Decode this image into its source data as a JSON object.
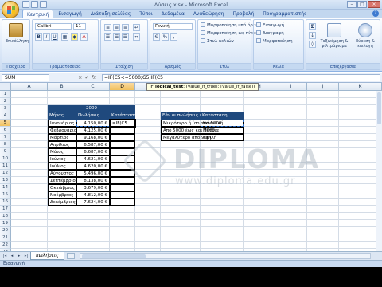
{
  "window": {
    "title": "Λύσεις.xlsx - Microsoft Excel",
    "controls": [
      "–",
      "□",
      "×"
    ]
  },
  "ribbon": {
    "tabs": [
      "Κεντρική",
      "Εισαγωγή",
      "Διάταξη σελίδας",
      "Τύποι",
      "Δεδομένα",
      "Αναθεώρηση",
      "Προβολή",
      "Προγραμματιστής"
    ],
    "active_tab": "Κεντρική",
    "groups": {
      "clipboard": {
        "label": "Πρόχειρο",
        "paste": "Επικόλληση"
      },
      "font": {
        "label": "Γραμματοσειρά",
        "font_name": "Calibri",
        "font_size": "11",
        "bold": "B",
        "italic": "I",
        "underline": "U"
      },
      "alignment": {
        "label": "Στοίχιση"
      },
      "number": {
        "label": "Αριθμός",
        "format": "Γενική",
        "currency": "€",
        "percent": "%"
      },
      "styles": {
        "label": "Στυλ",
        "cond_format": "Μορφοποίηση υπό όρους",
        "format_table": "Μορφοποίηση ως πίνακα",
        "cell_styles": "Στυλ κελιών"
      },
      "cells": {
        "label": "Κελιά",
        "insert": "Εισαγωγή",
        "delete": "Διαγραφή",
        "format": "Μορφοποίηση"
      },
      "editing": {
        "label": "Επεξεργασία",
        "sort": "Ταξινόμηση & φιλτράρισμα",
        "find": "Εύρεση & επιλογή"
      }
    }
  },
  "formula_bar": {
    "name_box": "SUM",
    "x": "×",
    "check": "✓",
    "fx": "fx",
    "formula": "=IF(C5<=5000;G5;IF(C5"
  },
  "tooltip": {
    "function": "IF(",
    "bold_arg": "logical_test",
    "rest": "; [value_if_true]; [value_if_false])"
  },
  "columns": [
    "A",
    "B",
    "C",
    "D",
    "E",
    "F",
    "G",
    "H",
    "I",
    "J",
    "K"
  ],
  "rows": [
    "1",
    "2",
    "3",
    "4",
    "5",
    "6",
    "7",
    "8",
    "9",
    "10",
    "11",
    "12",
    "13",
    "14",
    "15",
    "16",
    "17",
    "18",
    "19",
    "20",
    "21",
    "22",
    "23",
    "24",
    "25",
    "26",
    "27"
  ],
  "selected_column": "D",
  "selected_row": "5",
  "table1": {
    "year": "2009",
    "headers": [
      "Μήνας",
      "Πωλήσεις",
      "Κατάσταση"
    ],
    "months": [
      "Ιανουάριος",
      "Φεβρουάριος",
      "Μάρτιος",
      "Απρίλιος",
      "Μάιος",
      "Ιούνιος",
      "Ιούλιος",
      "Αύγουστος",
      "Σεπτέμβριος",
      "Οκτώβριος",
      "Νοέμβριος",
      "Δεκέμβριος"
    ],
    "sales": [
      "4.150,00 €",
      "4.125,00 €",
      "9.168,00 €",
      "6.587,00 €",
      "6.687,00 €",
      "4.621,00 €",
      "4.620,00 €",
      "5.496,00 €",
      "8.138,00 €",
      "3.679,00 €",
      "4.812,00 €",
      "7.624,00 €"
    ],
    "editing_cell": "=IF(C5"
  },
  "table2": {
    "headers": [
      "Εάν οι πωλήσεις είναι:",
      "Κατάσταση"
    ],
    "conditions": [
      "Μικρότερο ή ίσο από 5000",
      "Από 5000 έως και 9000",
      "Μεγαλύτερο από 9000"
    ],
    "statuses": [
      "Κανονική",
      "Μέτρια",
      "Υψηλή"
    ]
  },
  "watermark": {
    "brand": "DIPLOMA",
    "url": "www.diploma.edu.gr"
  },
  "sheet_tab": "πωλήσεις",
  "status_text": "Εισαγωγή"
}
